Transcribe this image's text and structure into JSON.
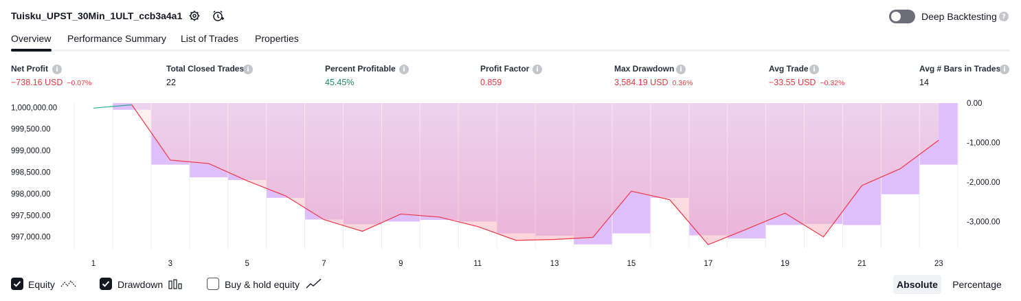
{
  "header": {
    "title": "Tuisku_UPST_30Min_1ULT_ccb3a4a1",
    "deep_backtesting_label": "Deep Backtesting",
    "deep_backtesting_enabled": false
  },
  "tabs": [
    {
      "label": "Overview",
      "active": true
    },
    {
      "label": "Performance Summary",
      "active": false
    },
    {
      "label": "List of Trades",
      "active": false
    },
    {
      "label": "Properties",
      "active": false
    }
  ],
  "stats": [
    {
      "label": "Net Profit",
      "value": "−738.16 USD",
      "pct": "−0.07%",
      "color": "red"
    },
    {
      "label": "Total Closed Trades",
      "value": "22",
      "pct": "",
      "color": "dark"
    },
    {
      "label": "Percent Profitable",
      "value": "45.45%",
      "pct": "",
      "color": "green"
    },
    {
      "label": "Profit Factor",
      "value": "0.859",
      "pct": "",
      "color": "red"
    },
    {
      "label": "Max Drawdown",
      "value": "3,584.19 USD",
      "pct": "0.36%",
      "color": "red"
    },
    {
      "label": "Avg Trade",
      "value": "−33.55 USD",
      "pct": "−0.32%",
      "color": "red"
    },
    {
      "label": "Avg # Bars in Trades",
      "value": "14",
      "pct": "",
      "color": "dark"
    }
  ],
  "chart_data": {
    "type": "line+bar",
    "x": [
      1,
      2,
      3,
      4,
      5,
      6,
      7,
      8,
      9,
      10,
      11,
      12,
      13,
      14,
      15,
      16,
      17,
      18,
      19,
      20,
      21,
      22,
      23
    ],
    "x_tick_labels": [
      "1",
      "3",
      "5",
      "7",
      "9",
      "11",
      "13",
      "15",
      "17",
      "19",
      "21",
      "23"
    ],
    "left_axis": {
      "ticks": [
        "1,000,000.00",
        "999,500.00",
        "999,000.00",
        "998,500.00",
        "998,000.00",
        "997,500.00",
        "997,000.00"
      ],
      "ylim": [
        996725,
        1000100
      ]
    },
    "right_axis": {
      "ticks": [
        "0.00",
        "-1,000.00",
        "-2,000.00",
        "-3,000.00"
      ],
      "ylim": [
        -3690,
        0
      ]
    },
    "series": [
      {
        "name": "Equity",
        "values": [
          999984,
          1000060,
          998780,
          998700,
          998300,
          997950,
          997400,
          997130,
          997530,
          997460,
          997240,
          996920,
          996940,
          996990,
          998060,
          997860,
          996820,
          997180,
          997550,
          997000,
          998190,
          998580,
          999240
        ]
      },
      {
        "name": "Drawdown",
        "values": [
          0,
          -170,
          -1560,
          -1880,
          -1950,
          -2400,
          -2950,
          -3070,
          -3000,
          -2960,
          -3000,
          -3300,
          -3360,
          -3580,
          -3300,
          -2400,
          -3350,
          -3430,
          -3090,
          -3060,
          -3090,
          -2310,
          -1560
        ]
      }
    ],
    "colors": {
      "equity_up": "#22ab94",
      "equity_down": "#f23645",
      "drawdown": "#ce93d8"
    }
  },
  "footer": {
    "legend": [
      {
        "label": "Equity",
        "checked": true,
        "icon": "equity-line-icon"
      },
      {
        "label": "Drawdown",
        "checked": true,
        "icon": "drawdown-bars-icon"
      },
      {
        "label": "Buy & hold equity",
        "checked": false,
        "icon": "buy-hold-line-icon"
      }
    ],
    "absolute_label": "Absolute",
    "percentage_label": "Percentage"
  }
}
